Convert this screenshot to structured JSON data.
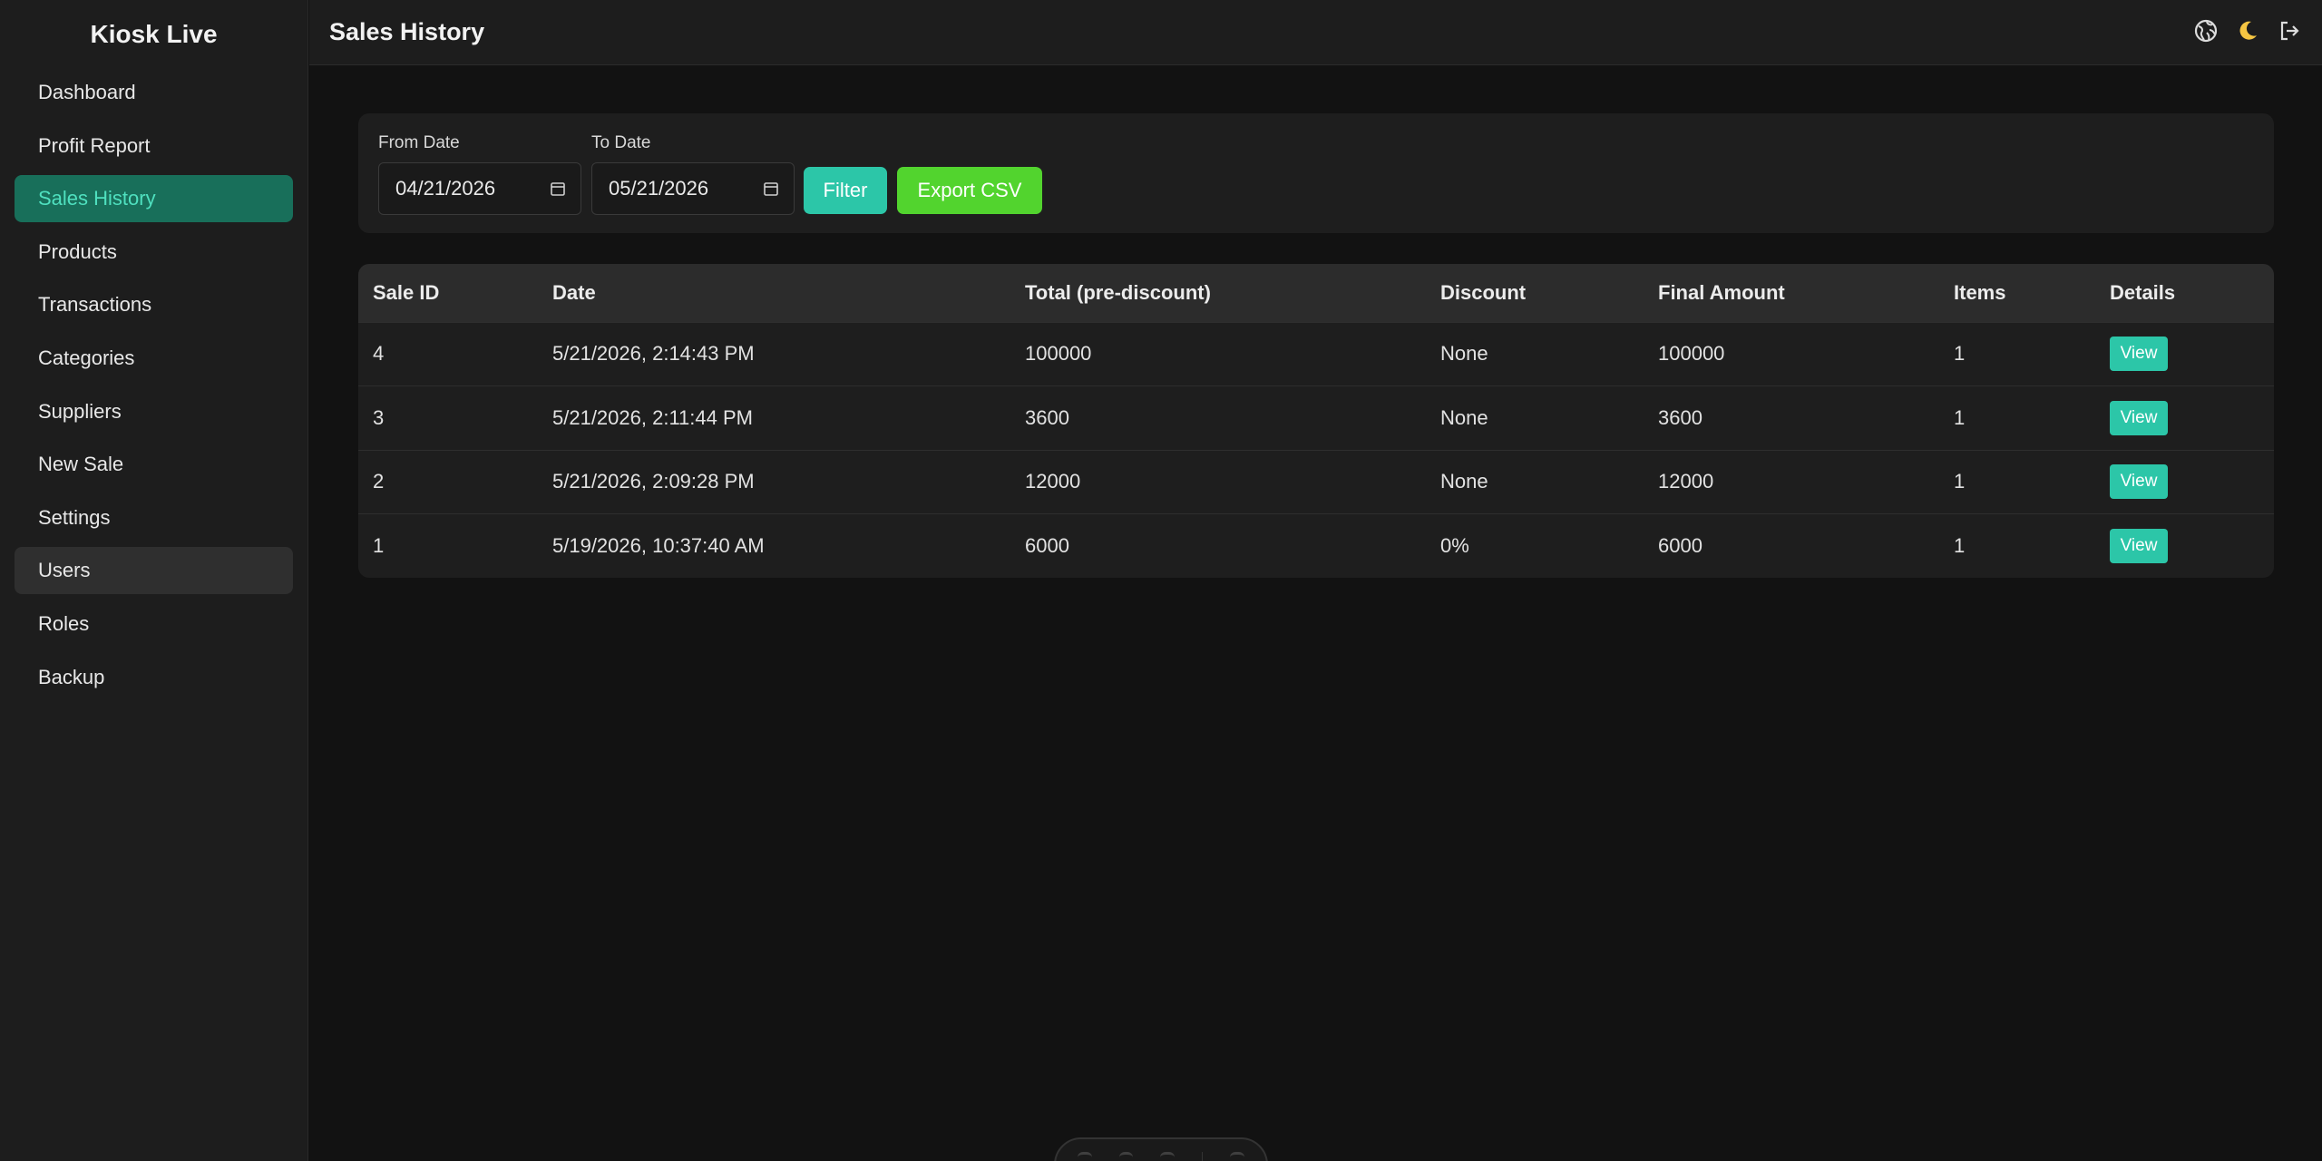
{
  "app": {
    "brand": "Kiosk Live"
  },
  "sidebar": {
    "items": [
      {
        "label": "Dashboard"
      },
      {
        "label": "Profit Report"
      },
      {
        "label": "Sales History",
        "active": true
      },
      {
        "label": "Products"
      },
      {
        "label": "Transactions"
      },
      {
        "label": "Categories"
      },
      {
        "label": "Suppliers"
      },
      {
        "label": "New Sale"
      },
      {
        "label": "Settings"
      },
      {
        "label": "Users",
        "hover": true
      },
      {
        "label": "Roles"
      },
      {
        "label": "Backup"
      }
    ]
  },
  "header": {
    "title": "Sales History",
    "icons": [
      "globe-icon",
      "moon-icon",
      "logout-icon"
    ]
  },
  "filters": {
    "from_label": "From Date",
    "from_value": "04/21/2026",
    "to_label": "To Date",
    "to_value": "05/21/2026",
    "filter_button": "Filter",
    "export_button": "Export CSV"
  },
  "table": {
    "columns": [
      "Sale ID",
      "Date",
      "Total (pre-discount)",
      "Discount",
      "Final Amount",
      "Items",
      "Details"
    ],
    "rows": [
      {
        "id": "4",
        "date": "5/21/2026, 2:14:43 PM",
        "total": "100000",
        "discount": "None",
        "final": "100000",
        "items": "1",
        "details": "View"
      },
      {
        "id": "3",
        "date": "5/21/2026, 2:11:44 PM",
        "total": "3600",
        "discount": "None",
        "final": "3600",
        "items": "1",
        "details": "View"
      },
      {
        "id": "2",
        "date": "5/21/2026, 2:09:28 PM",
        "total": "12000",
        "discount": "None",
        "final": "12000",
        "items": "1",
        "details": "View"
      },
      {
        "id": "1",
        "date": "5/19/2026, 10:37:40 AM",
        "total": "6000",
        "discount": "0%",
        "final": "6000",
        "items": "1",
        "details": "View"
      }
    ]
  },
  "colors": {
    "accent": "#2cc6a8",
    "active_nav_bg": "#186f5a",
    "active_nav_text": "#4fe0bf",
    "export_green": "#52d42e",
    "moon_yellow": "#f5c542"
  }
}
